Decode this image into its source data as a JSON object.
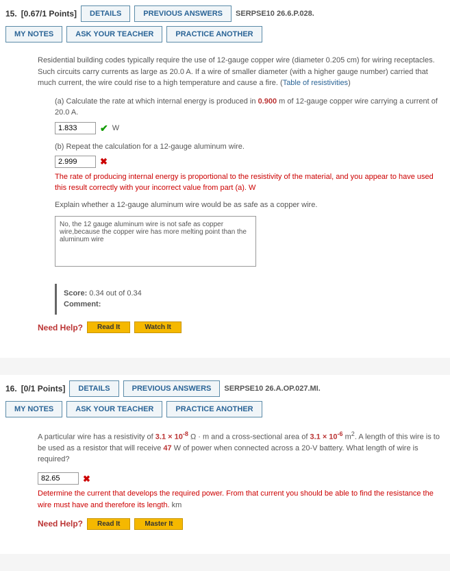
{
  "q15": {
    "num": "15.",
    "pts": "[0.67/1 Points]",
    "details": "DETAILS",
    "prev": "PREVIOUS ANSWERS",
    "src": "SERPSE10 26.6.P.028.",
    "notes": "MY NOTES",
    "ask": "ASK YOUR TEACHER",
    "practice": "PRACTICE ANOTHER",
    "intro": "Residential building codes typically require the use of 12-gauge copper wire (diameter 0.205 cm) for wiring receptacles. Such circuits carry currents as large as 20.0 A. If a wire of smaller diameter (with a higher gauge number) carried that much current, the wire could rise to a high temperature and cause a fire. (",
    "table_link": "Table of resistivities",
    "a_label": "(a) Calculate the rate at which internal energy is produced in ",
    "a_val": "0.900",
    "a_rest": " m of 12-gauge copper wire carrying a current of 20.0 A.",
    "a_ans": "1.833",
    "a_unit": "W",
    "b_label": "(b) Repeat the calculation for a 12-gauge aluminum wire.",
    "b_ans": "2.999",
    "b_err": "The rate of producing internal energy is proportional to the resistivity of the material, and you appear to have used this result correctly with your incorrect value from part (a).",
    "b_unit": " W",
    "c_label": "Explain whether a 12-gauge aluminum wire would be as safe as a copper wire.",
    "c_ans": "No, the 12 gauge aluminum wire is not safe as copper wire,because the copper wire has more melting point than the aluminum wire",
    "score_lbl": "Score:",
    "score_val": " 0.34 out of 0.34",
    "comment_lbl": "Comment:",
    "help": "Need Help?",
    "read": "Read It",
    "watch": "Watch It"
  },
  "q16": {
    "num": "16.",
    "pts": "[0/1 Points]",
    "details": "DETAILS",
    "prev": "PREVIOUS ANSWERS",
    "src": "SERPSE10 26.A.OP.027.MI.",
    "notes": "MY NOTES",
    "ask": "ASK YOUR TEACHER",
    "practice": "PRACTICE ANOTHER",
    "p1": "A particular wire has a resistivity of ",
    "v1": "3.1",
    "e1": "-8",
    "p2": " Ω · m and a cross-sectional area of ",
    "v2": "3.1",
    "e2": "-6",
    "p3": " m",
    "p3sup": "2",
    "p4": ". A length of this wire is to be used as a resistor that will receive ",
    "v3": "47",
    "p5": " W of power when connected across a 20-V battery. What length of wire is required?",
    "ans": "82.65",
    "err": "Determine the current that develops the required power. From that current you should be able to find the resistance the wire must have and therefore its length.",
    "unit": " km",
    "help": "Need Help?",
    "read": "Read It",
    "master": "Master It"
  }
}
